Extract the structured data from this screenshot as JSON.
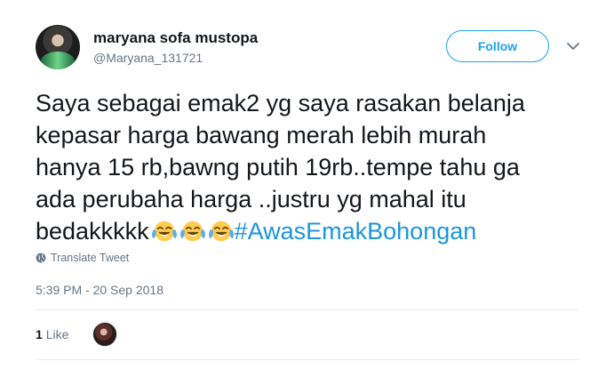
{
  "user": {
    "display_name": "maryana sofa mustopa",
    "handle": "@Maryana_131721",
    "avatar_icon": "user-avatar-photo"
  },
  "follow_label": "Follow",
  "tweet": {
    "lines": [
      "Saya sebagai emak2 yg saya rasakan belanja",
      "kepasar harga bawang merah  lebih murah",
      "hanya 15 rb,bawng putih 19rb..tempe tahu ga",
      "ada perubaha harga ..justru yg mahal itu",
      "bedakkkkk"
    ],
    "emoji_icon": "face-with-tears-of-joy-emoji",
    "emoji_count": 3,
    "hashtag": "#AwasEmakBohongan"
  },
  "translate_label": "Translate Tweet",
  "timestamp": "5:39 PM - 20 Sep 2018",
  "likes": {
    "count": "1",
    "label": "Like"
  },
  "colors": {
    "accent": "#1da1f2",
    "hashtag": "#1b95e0",
    "secondary_text": "#657786",
    "divider": "#e6ecf0"
  }
}
